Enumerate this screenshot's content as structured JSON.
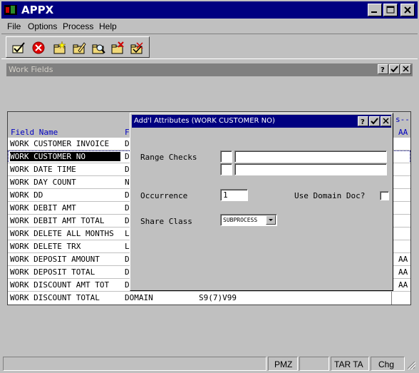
{
  "app": {
    "title": "APPX"
  },
  "menu": [
    {
      "label": "File"
    },
    {
      "label": "Options"
    },
    {
      "label": "Process"
    },
    {
      "label": "Help"
    }
  ],
  "toolbar": [
    {
      "icon": "ok-check-icon"
    },
    {
      "icon": "cancel-icon"
    },
    {
      "icon": "add-record-icon"
    },
    {
      "icon": "change-record-icon"
    },
    {
      "icon": "inquire-record-icon"
    },
    {
      "icon": "delete-record-icon"
    },
    {
      "icon": "scan-record-icon"
    }
  ],
  "work_fields": {
    "title": "Work Fields",
    "header": {
      "field_name": "Field Name",
      "f_col": "F",
      "right_top": "s--",
      "right_bottom": "AA"
    },
    "rows": [
      {
        "name": "WORK CUSTOMER INVOICE",
        "f": "D",
        "format": "",
        "right": ""
      },
      {
        "name": "WORK CUSTOMER NO",
        "f": "D",
        "format": "",
        "right": ""
      },
      {
        "name": "WORK DATE TIME",
        "f": "D",
        "format": "",
        "right": ""
      },
      {
        "name": "WORK DAY COUNT",
        "f": "N",
        "format": "",
        "right": ""
      },
      {
        "name": "WORK DD",
        "f": "D",
        "format": "",
        "right": ""
      },
      {
        "name": "WORK DEBIT AMT",
        "f": "D",
        "format": "",
        "right": ""
      },
      {
        "name": "WORK DEBIT AMT TOTAL",
        "f": "D",
        "format": "",
        "right": ""
      },
      {
        "name": "WORK DELETE ALL MONTHS",
        "f": "L",
        "format": "",
        "right": ""
      },
      {
        "name": "WORK DELETE TRX",
        "f": "L",
        "format": "",
        "right": ""
      },
      {
        "name": "WORK DEPOSIT AMOUNT",
        "f": "D",
        "format": "",
        "right": "AA"
      },
      {
        "name": "WORK DEPOSIT TOTAL",
        "f": "D",
        "format": "",
        "right": "AA"
      },
      {
        "name": "WORK DISCOUNT AMT TOT",
        "f": "D",
        "format": "",
        "right": "AA"
      },
      {
        "name": "WORK DISCOUNT TOTAL",
        "f": "DOMAIN",
        "format": "S9(7)V99",
        "right": ""
      }
    ]
  },
  "dialog": {
    "title": "Add'l Attributes (WORK CUSTOMER NO)",
    "range_checks_label": "Range Checks",
    "occurrence_label": "Occurrence",
    "occurrence_value": "1",
    "use_domain_doc_label": "Use Domain Doc?",
    "share_class_label": "Share Class",
    "share_class_value": "SUBPROCESS"
  },
  "status": {
    "pmz": "PMZ",
    "tar_ta": "TAR TA",
    "chg": "Chg"
  }
}
